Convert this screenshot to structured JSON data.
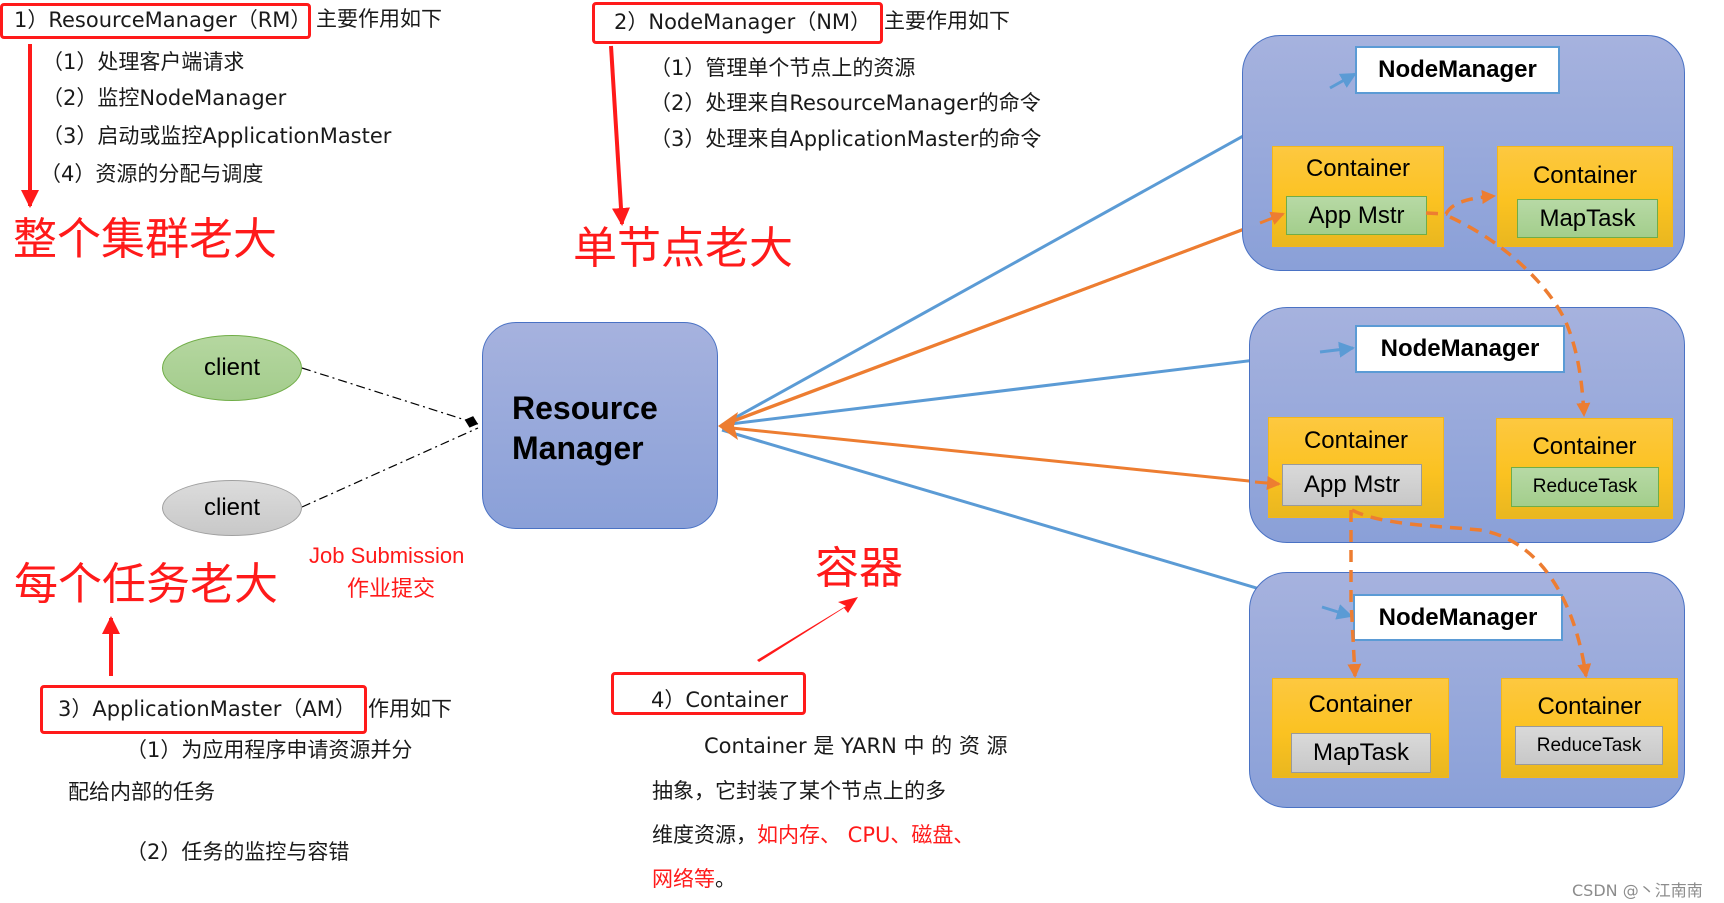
{
  "rm_section": {
    "title": "1）ResourceManager（RM）",
    "title_suffix": "主要作用如下",
    "items": [
      "（1）处理客户端请求",
      "（2）监控NodeManager",
      "（3）启动或监控ApplicationMaster",
      "（4）资源的分配与调度"
    ],
    "callout": "整个集群老大"
  },
  "nm_section": {
    "title": "2）NodeManager（NM）",
    "title_suffix": "主要作用如下",
    "items": [
      "（1）管理单个节点上的资源",
      "（2）处理来自ResourceManager的命令",
      "（3）处理来自ApplicationMaster的命令"
    ],
    "callout": "单节点老大"
  },
  "am_section": {
    "title": "3）ApplicationMaster（AM）",
    "title_suffix": "作用如下",
    "items": [
      "（1）为应用程序申请资源并分",
      "配给内部的任务",
      "（2）任务的监控与容错"
    ],
    "callout": "每个任务老大"
  },
  "container_section": {
    "title": "4）Container",
    "callout": "容器",
    "desc_lines": [
      "Container 是 YARN 中 的 资 源",
      "抽象，它封装了某个节点上的多"
    ],
    "desc_line3_black": "维度资源，",
    "desc_line3_red": "如内存、 CPU、磁盘、",
    "desc_line4_red": "网络等",
    "desc_line4_black": "。"
  },
  "diagram": {
    "clients": [
      {
        "label": "client",
        "color": "green"
      },
      {
        "label": "client",
        "color": "gray"
      }
    ],
    "job_submission": "Job Submission",
    "job_submission_cn": "作业提交",
    "resource_manager": [
      "Resource",
      "Manager"
    ],
    "nodes": [
      {
        "manager": "NodeManager",
        "containers": [
          {
            "label": "Container",
            "task": "App Mstr",
            "task_color": "green"
          },
          {
            "label": "Container",
            "task": "MapTask",
            "task_color": "green"
          }
        ]
      },
      {
        "manager": "NodeManager",
        "containers": [
          {
            "label": "Container",
            "task": "App Mstr",
            "task_color": "gray"
          },
          {
            "label": "Container",
            "task": "ReduceTask",
            "task_color": "green"
          }
        ]
      },
      {
        "manager": "NodeManager",
        "containers": [
          {
            "label": "Container",
            "task": "MapTask",
            "task_color": "gray"
          },
          {
            "label": "Container",
            "task": "ReduceTask",
            "task_color": "gray"
          }
        ]
      }
    ],
    "colors": {
      "rm_link": "#5b9bd5",
      "am_link": "#ed7d31",
      "annotation": "#ff1a1a",
      "node_border": "#4472c4",
      "container": "#fbc221"
    }
  },
  "watermark": "CSDN @丶江南南"
}
